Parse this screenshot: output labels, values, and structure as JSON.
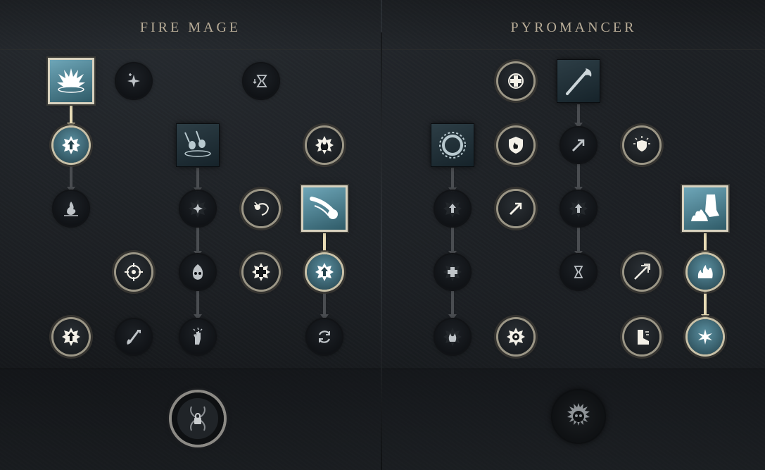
{
  "trees": {
    "left": {
      "title": "FIRE MAGE"
    },
    "right": {
      "title": "PYROMANCER"
    }
  }
}
